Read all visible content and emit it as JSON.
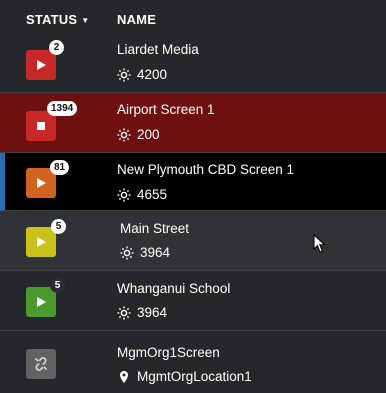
{
  "header": {
    "status_label": "STATUS",
    "name_label": "NAME"
  },
  "rows": [
    {
      "badge": "2",
      "title": "Liardet Media",
      "sub": "4200",
      "status": "play",
      "tile_color": "#c62828",
      "sub_icon": "brightness-icon"
    },
    {
      "badge": "1394",
      "title": "Airport Screen 1",
      "sub": "200",
      "status": "stop",
      "tile_color": "#c62828",
      "sub_icon": "brightness-icon"
    },
    {
      "badge": "81",
      "title": "New Plymouth CBD Screen 1",
      "sub": "4655",
      "status": "play",
      "tile_color": "#d2621f",
      "sub_icon": "brightness-icon"
    },
    {
      "badge": "5",
      "title": "Main Street",
      "sub": "3964",
      "status": "play",
      "tile_color": "#c9c21b",
      "sub_icon": "brightness-icon"
    },
    {
      "badge": "5",
      "title": "Whanganui School",
      "sub": "3964",
      "status": "play",
      "tile_color": "#4a9a2e",
      "sub_icon": "brightness-icon"
    },
    {
      "badge": "",
      "title": "MgmOrg1Screen",
      "sub": "MgmtOrgLocation1",
      "status": "unlinked",
      "tile_color": "#5f6366",
      "sub_icon": "location-pin-icon"
    }
  ],
  "colors": {
    "background": "#24282c",
    "selected_row": "#6e1010",
    "active_row": "#000000",
    "hover_row": "#2f3338",
    "selection_bar": "#2a6db3"
  }
}
